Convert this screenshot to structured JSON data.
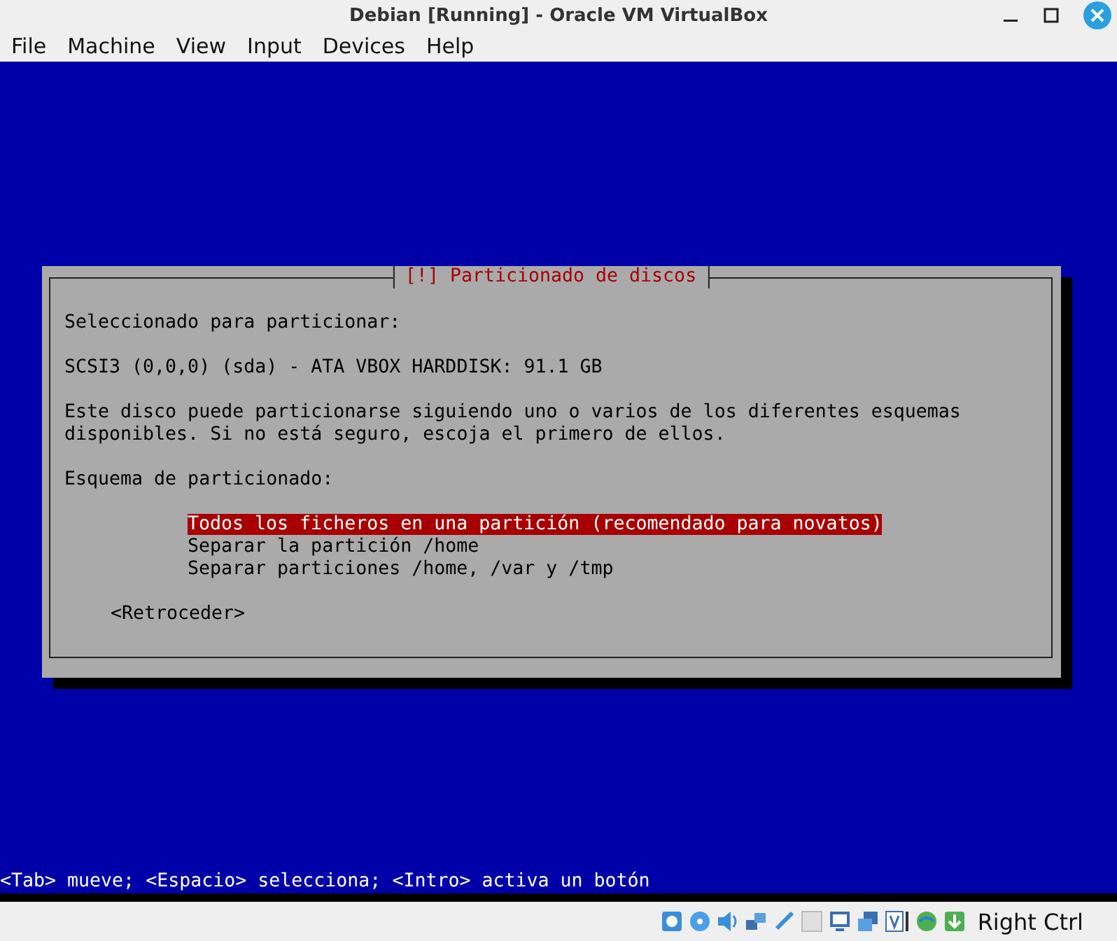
{
  "window": {
    "title": "Debian [Running] - Oracle VM VirtualBox"
  },
  "menu": [
    "File",
    "Machine",
    "View",
    "Input",
    "Devices",
    "Help"
  ],
  "dialog": {
    "title": "[!] Particionado de discos",
    "paragraphs": [
      "Seleccionado para particionar:",
      "SCSI3 (0,0,0) (sda) - ATA VBOX HARDDISK: 91.1 GB",
      "Este disco puede particionarse siguiendo uno o varios de los diferentes esquemas\ndisponibles. Si no está seguro, escoja el primero de ellos.",
      "Esquema de particionado:"
    ],
    "options": [
      {
        "label": "Todos los ficheros en una partición (recomendado para novatos)",
        "selected": true
      },
      {
        "label": "Separar la partición /home",
        "selected": false
      },
      {
        "label": "Separar particiones /home, /var y /tmp",
        "selected": false
      }
    ],
    "button": "<Retroceder>"
  },
  "help": "<Tab> mueve; <Espacio> selecciona; <Intro> activa un botón",
  "status_bar": {
    "host_key": "Right Ctrl"
  }
}
